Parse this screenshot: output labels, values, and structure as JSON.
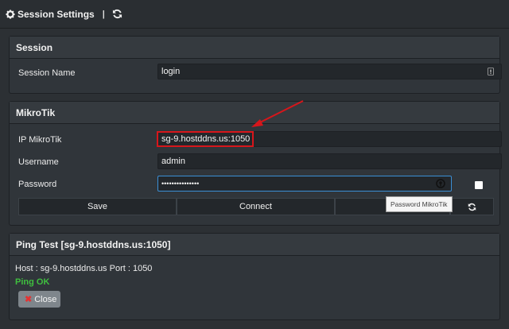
{
  "header": {
    "title": "Session Settings",
    "separator": "|"
  },
  "session": {
    "heading": "Session",
    "name_label": "Session Name",
    "name_value": "login"
  },
  "mikrotik": {
    "heading": "MikroTik",
    "ip_label": "IP MikroTik",
    "ip_value": "sg-9.hostddns.us:1050",
    "username_label": "Username",
    "username_value": "admin",
    "password_label": "Password",
    "password_value": "•••••••••••••••",
    "save_label": "Save",
    "connect_label": "Connect",
    "tooltip": "Password MikroTik"
  },
  "ping": {
    "heading": "Ping Test [sg-9.hostddns.us:1050]",
    "host_line": "Host : sg-9.hostddns.us Port : 1050",
    "status": "Ping OK",
    "close_label": "Close"
  },
  "colors": {
    "highlight": "#d7161b",
    "ok": "#3fbf3f",
    "focus": "#3b8fd6"
  }
}
